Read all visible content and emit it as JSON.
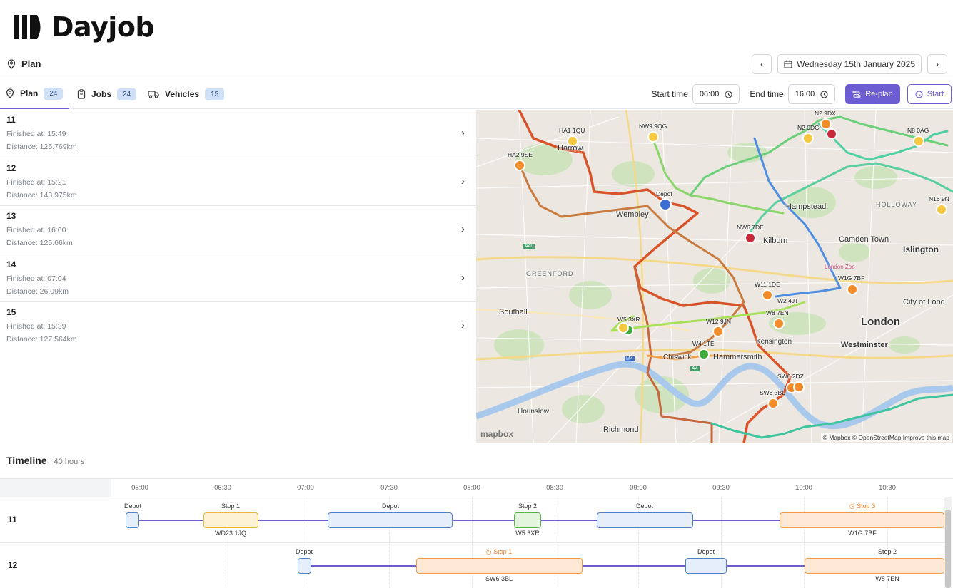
{
  "brand": {
    "name": "Dayjob"
  },
  "subheader": {
    "title": "Plan",
    "date": "Wednesday 15th January 2025"
  },
  "tabs": [
    {
      "label": "Plan",
      "count": "24"
    },
    {
      "label": "Jobs",
      "count": "24"
    },
    {
      "label": "Vehicles",
      "count": "15"
    }
  ],
  "controls": {
    "start_label": "Start time",
    "start_value": "06:00",
    "end_label": "End time",
    "end_value": "16:00",
    "replan_label": "Re-plan",
    "start_button": "Start"
  },
  "plans": [
    {
      "id": "11",
      "finished": "Finished at: 15:49",
      "distance": "Distance: 125.769km"
    },
    {
      "id": "12",
      "finished": "Finished at: 15:21",
      "distance": "Distance: 143.975km"
    },
    {
      "id": "13",
      "finished": "Finished at: 16:00",
      "distance": "Distance: 125.66km"
    },
    {
      "id": "14",
      "finished": "Finished at: 07:04",
      "distance": "Distance: 26.09km"
    },
    {
      "id": "15",
      "finished": "Finished at: 15:39",
      "distance": "Distance: 127.564km"
    }
  ],
  "map": {
    "stops": [
      "N2 9DX",
      "HA1 1QU",
      "NW9 9QG",
      "N2 0DG",
      "N8 0AG",
      "HA2 9SE",
      "Depot",
      "N16 9N",
      "NW6 7DE",
      "W1G 7BF",
      "W11 1DE",
      "W2 4JT",
      "W8 7EN",
      "W5 3XR",
      "W12 9JN",
      "W4 1TE",
      "SW6 2DZ",
      "SW6 3BL"
    ],
    "places": [
      "Harrow",
      "Wembley",
      "Hampstead",
      "HOLLOWAY",
      "Kilburn",
      "Camden Town",
      "Islington",
      "London Zoo",
      "GREENFORD",
      "Southall",
      "City of Lond",
      "London",
      "Westminster",
      "Kensington",
      "Chiswick",
      "Hammersmith",
      "Hounslow",
      "Richmond",
      "A40",
      "A4",
      "M4"
    ],
    "attribution": "© Mapbox © OpenStreetMap Improve this map",
    "logo": "mapbox"
  },
  "timeline": {
    "title": "Timeline",
    "subtitle": "40 hours",
    "ticks": [
      "06:00",
      "06:30",
      "07:00",
      "07:30",
      "08:00",
      "08:30",
      "09:00",
      "09:30",
      "10:00",
      "10:30"
    ],
    "rows": [
      {
        "id": "11",
        "tops": [
          "Depot",
          "Stop 1",
          "Depot",
          "Stop 2",
          "Depot",
          "Stop 3"
        ],
        "bottoms": [
          "WD23 1JQ",
          "W5 3XR",
          "W1G 7BF"
        ]
      },
      {
        "id": "12",
        "tops": [
          "Depot",
          "Stop 1",
          "Depot",
          "Stop 2"
        ],
        "bottoms": [
          "SW6 3BL",
          "W8 7EN"
        ]
      }
    ]
  },
  "colors": {
    "accent": "#6d5dd3",
    "depot": "#4f7fc4",
    "stop_yellow": "#f5c842",
    "stop_orange": "#f28c28",
    "stop_red": "#c8283a",
    "stop_green": "#3faa3a"
  }
}
